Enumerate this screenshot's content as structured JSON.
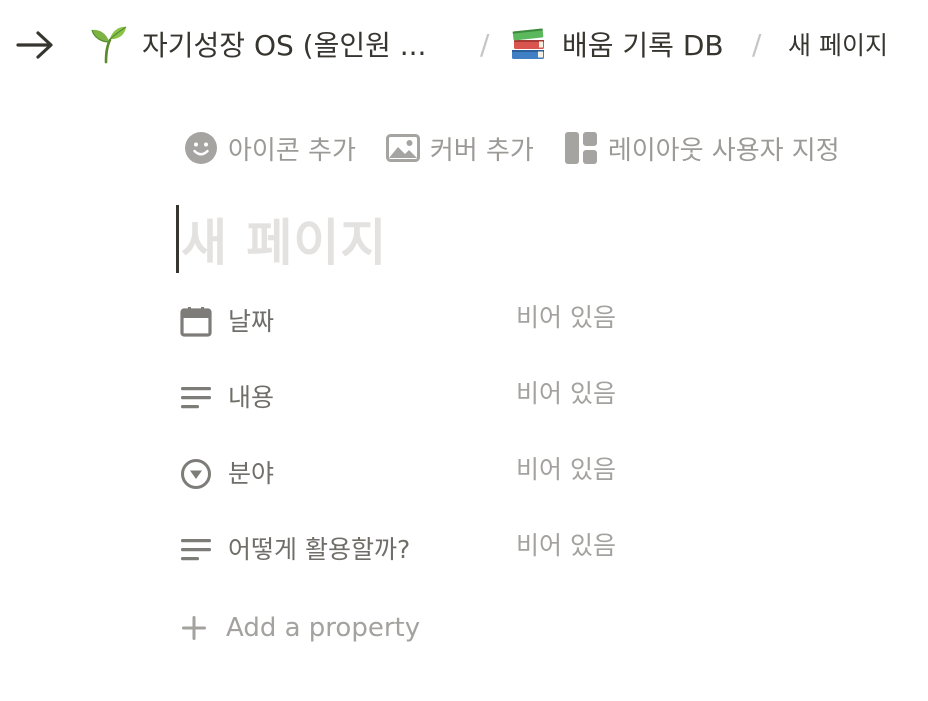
{
  "breadcrumb": {
    "items": [
      {
        "emoji": "sprout-icon",
        "label": "자기성장 OS (올인원 ..."
      },
      {
        "emoji": "books-icon",
        "label": "배움 기록 DB"
      },
      {
        "label": "새 페이지"
      }
    ],
    "separator": "/"
  },
  "page_controls": {
    "add_icon": "아이콘 추가",
    "add_cover": "커버 추가",
    "customize_layout": "레이아웃 사용자 지정"
  },
  "page": {
    "title_placeholder": "새 페이지"
  },
  "properties": [
    {
      "icon": "calendar-icon",
      "label": "날짜",
      "value": "비어 있음"
    },
    {
      "icon": "text-lines-icon",
      "label": "내용",
      "value": "비어 있음"
    },
    {
      "icon": "select-circle-icon",
      "label": "분야",
      "value": "비어 있음"
    },
    {
      "icon": "text-lines-icon",
      "label": "어떻게 활용할까?",
      "value": "비어 있음"
    }
  ],
  "add_property": "Add a property",
  "colors": {
    "text_primary": "#37352f",
    "text_muted": "#9b9a97",
    "title_placeholder": "#e3e2e0"
  }
}
